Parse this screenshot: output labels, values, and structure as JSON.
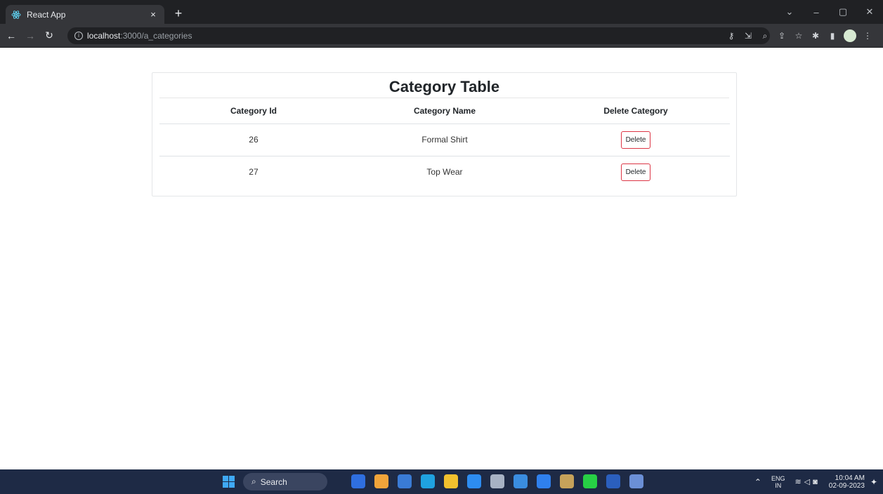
{
  "browser": {
    "tab_title": "React App",
    "tab_close": "×",
    "new_tab": "+",
    "url_host": "localhost",
    "url_path": ":3000/a_categories",
    "window_controls": [
      "⌄",
      "–",
      "▢",
      "✕"
    ]
  },
  "page": {
    "title": "Category Table",
    "columns": [
      "Category Id",
      "Category Name",
      "Delete Category"
    ],
    "rows": [
      {
        "id": "26",
        "name": "Formal Shirt",
        "action": "Delete"
      },
      {
        "id": "27",
        "name": "Top Wear",
        "action": "Delete"
      }
    ],
    "accent_color": "#dc3545"
  },
  "taskbar": {
    "search_label": "Search",
    "language_line1": "ENG",
    "language_line2": "IN",
    "time": "10:04 AM",
    "date": "02-09-2023",
    "app_colors": [
      "#2f6fe0",
      "#f0a43a",
      "#3a7bd5",
      "#1fa2e0",
      "#f2c12e",
      "#2d8cf0",
      "#a7b2c4",
      "#3a8de0",
      "#2f80ed",
      "#c6a25a",
      "#27d045",
      "#2b5fbd",
      "#6b8fd6"
    ]
  }
}
